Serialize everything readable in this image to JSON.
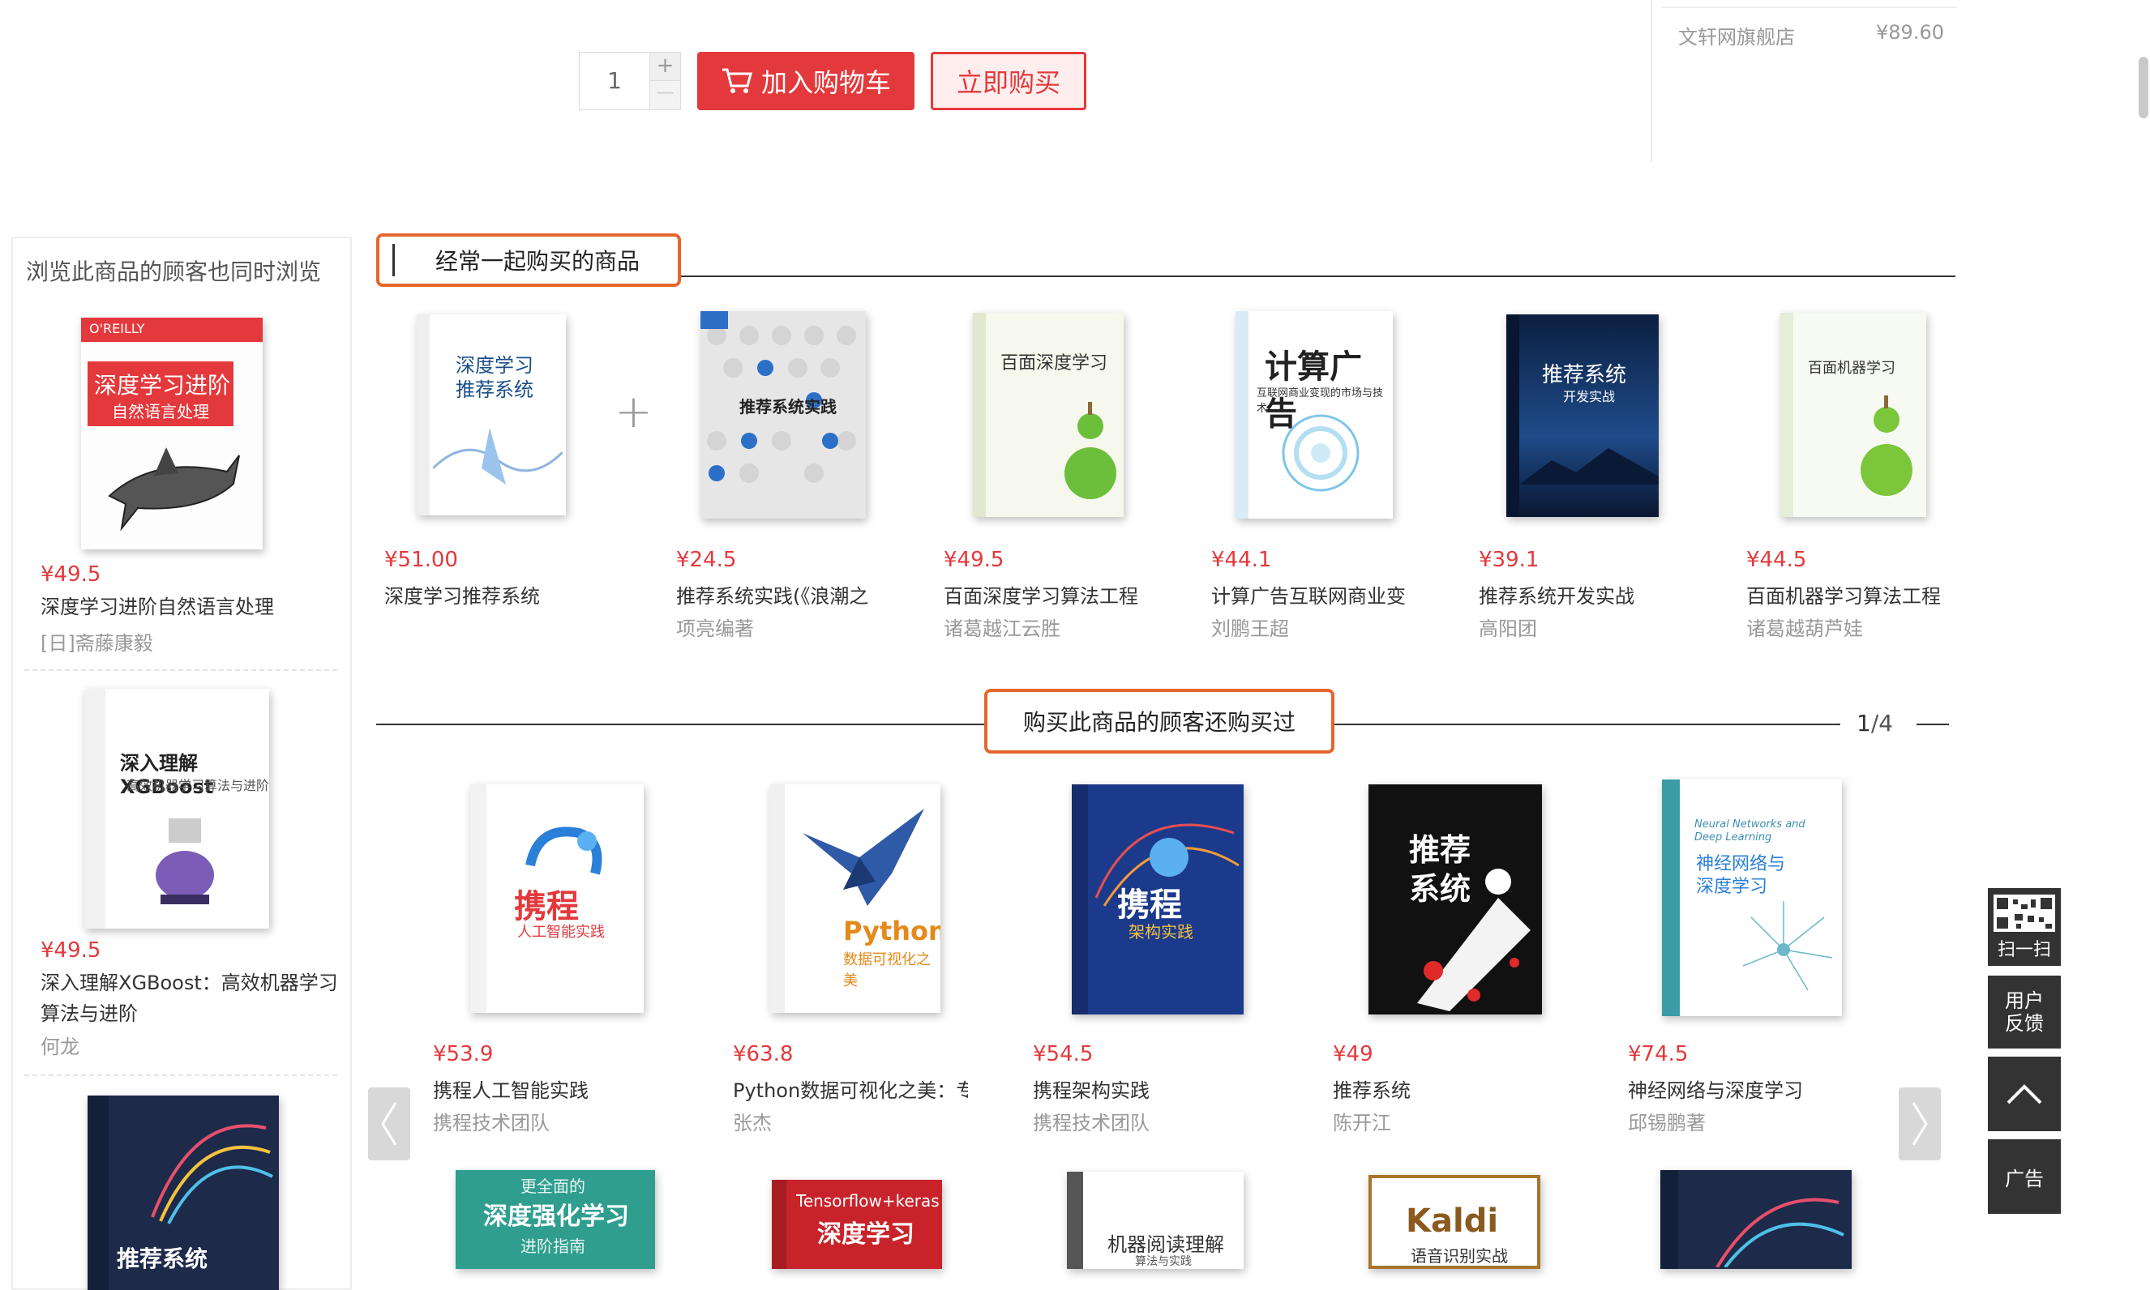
{
  "purchase": {
    "qty": "1",
    "plus": "+",
    "minus": "—",
    "add_to_cart": "加入购物车",
    "buy_now": "立即购买"
  },
  "store": {
    "name": "文轩网旗舰店",
    "price": "¥89.60"
  },
  "sidebar": {
    "title": "浏览此商品的顾客也同时浏览",
    "items": [
      {
        "price": "¥49.5",
        "title": "深度学习进阶自然语言处理",
        "author": "[日]斋藤康毅"
      },
      {
        "price": "¥49.5",
        "title": "深入理解XGBoost：高效机器学习算法与进阶",
        "author": "何龙"
      },
      {
        "price": "",
        "title": "",
        "author": ""
      }
    ]
  },
  "bundle": {
    "title": "经常一起购买的商品",
    "plus": "+",
    "items": [
      {
        "price": "¥51.00",
        "title": "深度学习推荐系统",
        "author": ""
      },
      {
        "price": "¥24.5",
        "title": "推荐系统实践(《浪潮之",
        "author": "项亮编著"
      },
      {
        "price": "¥49.5",
        "title": "百面深度学习算法工程",
        "author": "诸葛越江云胜"
      },
      {
        "price": "¥44.1",
        "title": "计算广告互联网商业变",
        "author": "刘鹏王超"
      },
      {
        "price": "¥39.1",
        "title": "推荐系统开发实战",
        "author": "高阳团"
      },
      {
        "price": "¥44.5",
        "title": "百面机器学习算法工程",
        "author": "诸葛越葫芦娃"
      }
    ]
  },
  "also_bought": {
    "title": "购买此商品的顾客还购买过",
    "page": "1",
    "total": "/4",
    "items": [
      {
        "price": "¥53.9",
        "title": "携程人工智能实践",
        "author": "携程技术团队"
      },
      {
        "price": "¥63.8",
        "title": "Python数据可视化之美：专",
        "author": "张杰"
      },
      {
        "price": "¥54.5",
        "title": "携程架构实践",
        "author": "携程技术团队"
      },
      {
        "price": "¥49",
        "title": "推荐系统",
        "author": "陈开江"
      },
      {
        "price": "¥74.5",
        "title": "神经网络与深度学习",
        "author": "邱锡鹏著"
      }
    ]
  },
  "covers": {
    "sb1_main": "深度学习进阶",
    "sb1_sub": "自然语言处理",
    "sb1_brand": "O'REILLY",
    "sb2_main": "深入理解XGBoost",
    "sb2_sub": "高效机器学习算法与进阶",
    "sb3_main": "推荐系统",
    "b1": "深度学习\n推荐系统",
    "b2": "推荐系统实践",
    "b3": "百面深度学习",
    "b4": "计算广告",
    "b4_sub": "互联网商业变现的市场与技术",
    "b5": "推荐系统",
    "b5_sub": "开发实战",
    "b6": "百面机器学习",
    "a1": "携程",
    "a1_sub": "人工智能实践",
    "a2": "Python",
    "a2_sub": "数据可视化之美",
    "a3": "携程",
    "a3_sub": "架构实践",
    "a4": "推荐",
    "a4_b": "系统",
    "a5": "神经网络与",
    "a5_b": "深度学习",
    "a5_en": "Neural Networks and Deep Learning",
    "r1": "深度强化学习",
    "r1_top": "更全面的",
    "r1_sub": "进阶指南",
    "r2": "深度学习",
    "r2_top": "Tensorflow+keras",
    "r3": "机器阅读理解",
    "r3_sub": "算法与实践",
    "r4": "Kaldi",
    "r4_sub": "语音识别实战"
  },
  "tools": {
    "scan": "扫一扫",
    "feedback1": "用户",
    "feedback2": "反馈",
    "ad": "广告"
  },
  "colors": {
    "accent": "#e4393c",
    "heading_border": "#e4662d",
    "tool_bg": "#333333"
  }
}
